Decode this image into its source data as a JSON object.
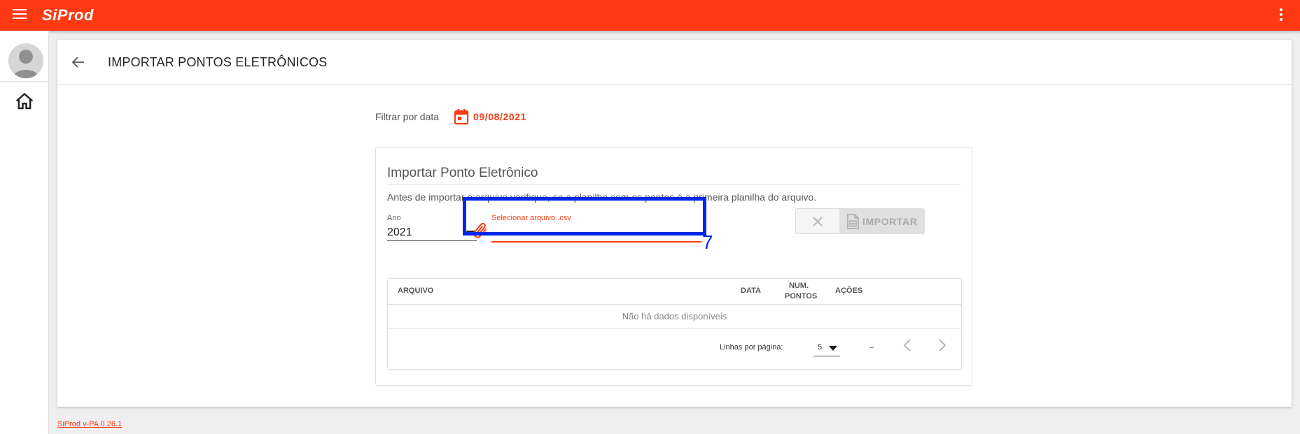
{
  "app": {
    "logo": "SiProd"
  },
  "colors": {
    "primary": "#ff3a12",
    "highlight": "#0027e8"
  },
  "icons": {
    "menu": "menu-icon",
    "more": "more-vert-icon",
    "avatar": "avatar-icon",
    "home": "home-icon",
    "back": "arrow-back-icon",
    "calendar": "calendar-icon",
    "attach": "paperclip-icon",
    "clear": "close-icon",
    "import": "csv-file-icon",
    "prev": "chevron-left-icon",
    "next": "chevron-right-icon"
  },
  "page": {
    "title": "IMPORTAR PONTOS ELETRÔNICOS"
  },
  "filter": {
    "label": "Filtrar por data",
    "date": "09/08/2021"
  },
  "import_panel": {
    "title": "Importar Ponto Eletrônico",
    "description": "Antes de importar o arquivo verifique, se a planilha com os pontos é a primeira planilha do arquivo.",
    "year_label": "Ano",
    "year_value": "2021",
    "file_label": "Selecionar arquivo .csv",
    "annotation": "7",
    "import_button": "IMPORTAR"
  },
  "table": {
    "headers": [
      "ARQUIVO",
      "DATA",
      "NUM. PONTOS",
      "AÇÕES"
    ],
    "empty_text": "Não há dados disponíveis",
    "rows_per_page_label": "Linhas por página:",
    "rows_per_page_value": "5",
    "range": "–"
  },
  "footer": {
    "version": "SiProd v-PA 0.26.1"
  }
}
